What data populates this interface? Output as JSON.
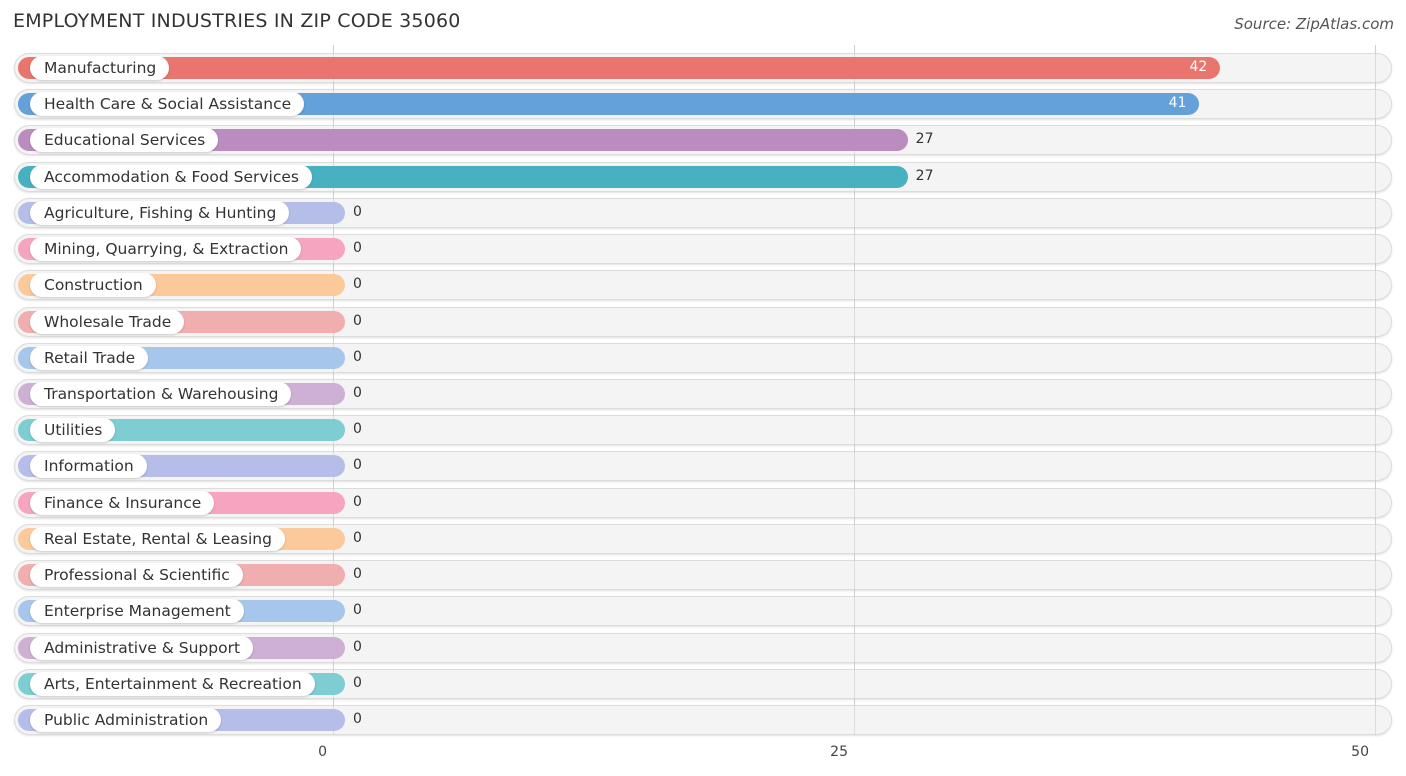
{
  "header": {
    "title": "EMPLOYMENT INDUSTRIES IN ZIP CODE 35060",
    "source": "Source: ZipAtlas.com"
  },
  "chart_data": {
    "type": "bar",
    "orientation": "horizontal",
    "title": "EMPLOYMENT INDUSTRIES IN ZIP CODE 35060",
    "xlabel": "",
    "ylabel": "",
    "xlim": [
      0,
      50
    ],
    "xticks": [
      0,
      25,
      50
    ],
    "xtick_labels": [
      "0",
      "25",
      "50"
    ],
    "grid": true,
    "categories": [
      "Manufacturing",
      "Health Care & Social Assistance",
      "Educational Services",
      "Accommodation & Food Services",
      "Agriculture, Fishing & Hunting",
      "Mining, Quarrying, & Extraction",
      "Construction",
      "Wholesale Trade",
      "Retail Trade",
      "Transportation & Warehousing",
      "Utilities",
      "Information",
      "Finance & Insurance",
      "Real Estate, Rental & Leasing",
      "Professional & Scientific",
      "Enterprise Management",
      "Administrative & Support",
      "Arts, Entertainment & Recreation",
      "Public Administration"
    ],
    "values": [
      42,
      41,
      27,
      27,
      0,
      0,
      0,
      0,
      0,
      0,
      0,
      0,
      0,
      0,
      0,
      0,
      0,
      0,
      0
    ],
    "value_labels": [
      "42",
      "41",
      "27",
      "27",
      "0",
      "0",
      "0",
      "0",
      "0",
      "0",
      "0",
      "0",
      "0",
      "0",
      "0",
      "0",
      "0",
      "0",
      "0"
    ],
    "colors": [
      "#e8766f",
      "#64a0da",
      "#bb8cc0",
      "#47b1c2",
      "#b5bde9",
      "#f6a5c1",
      "#fbc99a",
      "#f0aeae",
      "#a7c6eb",
      "#cdb0d3",
      "#7dcdd2",
      "#b5bde9",
      "#f6a5c1",
      "#fbc99a",
      "#f0aeae",
      "#a7c6eb",
      "#cdb0d3",
      "#7dcdd2",
      "#b5bde9"
    ]
  }
}
